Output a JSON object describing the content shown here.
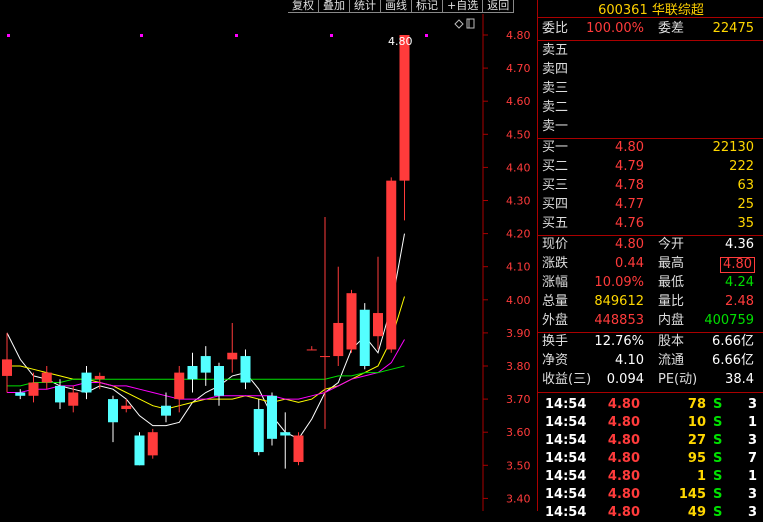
{
  "toolbar": [
    "复权",
    "叠加",
    "统计",
    "画线",
    "标记",
    "+自选",
    "返回"
  ],
  "stock": {
    "code": "600361",
    "name": "华联综超"
  },
  "order_ratio": {
    "label1": "委比",
    "value1": "100.00%",
    "label2": "委差",
    "value2": "22475"
  },
  "sell": [
    {
      "label": "卖五"
    },
    {
      "label": "卖四"
    },
    {
      "label": "卖三"
    },
    {
      "label": "卖二"
    },
    {
      "label": "卖一"
    }
  ],
  "buy": [
    {
      "label": "买一",
      "price": "4.80",
      "vol": "22130"
    },
    {
      "label": "买二",
      "price": "4.79",
      "vol": "222"
    },
    {
      "label": "买三",
      "price": "4.78",
      "vol": "63"
    },
    {
      "label": "买四",
      "price": "4.77",
      "vol": "25"
    },
    {
      "label": "买五",
      "price": "4.76",
      "vol": "35"
    }
  ],
  "quote": {
    "now_label": "现价",
    "now": "4.80",
    "open_label": "今开",
    "open": "4.36",
    "chg_label": "涨跌",
    "chg": "0.44",
    "high_label": "最高",
    "high": "4.80",
    "pct_label": "涨幅",
    "pct": "10.09%",
    "low_label": "最低",
    "low": "4.24",
    "vol_label": "总量",
    "vol": "849612",
    "vr_label": "量比",
    "vr": "2.48",
    "out_label": "外盘",
    "out": "448853",
    "in_label": "内盘",
    "in": "400759"
  },
  "fund": {
    "turn_label": "换手",
    "turn": "12.76%",
    "cap_label": "股本",
    "cap": "6.66亿",
    "nav_label": "净资",
    "nav": "4.10",
    "float_label": "流通",
    "float": "6.66亿",
    "eps_label": "收益(三)",
    "eps": "0.094",
    "pe_label": "PE(动)",
    "pe": "38.4"
  },
  "ticks": [
    {
      "time": "14:54",
      "price": "4.80",
      "vol": "78",
      "side": "S",
      "n": "3"
    },
    {
      "time": "14:54",
      "price": "4.80",
      "vol": "10",
      "side": "S",
      "n": "1"
    },
    {
      "time": "14:54",
      "price": "4.80",
      "vol": "27",
      "side": "S",
      "n": "3"
    },
    {
      "time": "14:54",
      "price": "4.80",
      "vol": "95",
      "side": "S",
      "n": "7"
    },
    {
      "time": "14:54",
      "price": "4.80",
      "vol": "1",
      "side": "S",
      "n": "1"
    },
    {
      "time": "14:54",
      "price": "4.80",
      "vol": "145",
      "side": "S",
      "n": "3"
    },
    {
      "time": "14:54",
      "price": "4.80",
      "vol": "49",
      "side": "S",
      "n": "3"
    }
  ],
  "chart_data": {
    "type": "candlestick",
    "y_ticks": [
      "4.80",
      "4.70",
      "4.60",
      "4.50",
      "4.40",
      "4.30",
      "4.20",
      "4.10",
      "4.00",
      "3.90",
      "3.80",
      "3.70",
      "3.60",
      "3.50",
      "3.40"
    ],
    "high_marker": "4.80",
    "ylim": [
      3.35,
      4.83
    ],
    "candles": [
      {
        "o": 3.77,
        "c": 3.82,
        "h": 3.9,
        "l": 3.72
      },
      {
        "o": 3.72,
        "c": 3.71,
        "h": 3.73,
        "l": 3.7
      },
      {
        "o": 3.71,
        "c": 3.75,
        "h": 3.78,
        "l": 3.69
      },
      {
        "o": 3.75,
        "c": 3.78,
        "h": 3.8,
        "l": 3.73
      },
      {
        "o": 3.74,
        "c": 3.69,
        "h": 3.76,
        "l": 3.67
      },
      {
        "o": 3.68,
        "c": 3.72,
        "h": 3.74,
        "l": 3.66
      },
      {
        "o": 3.78,
        "c": 3.72,
        "h": 3.8,
        "l": 3.7
      },
      {
        "o": 3.76,
        "c": 3.77,
        "h": 3.78,
        "l": 3.73
      },
      {
        "o": 3.7,
        "c": 3.63,
        "h": 3.71,
        "l": 3.57
      },
      {
        "o": 3.67,
        "c": 3.68,
        "h": 3.7,
        "l": 3.66
      },
      {
        "o": 3.59,
        "c": 3.5,
        "h": 3.6,
        "l": 3.5
      },
      {
        "o": 3.53,
        "c": 3.6,
        "h": 3.61,
        "l": 3.52
      },
      {
        "o": 3.68,
        "c": 3.65,
        "h": 3.72,
        "l": 3.63
      },
      {
        "o": 3.7,
        "c": 3.78,
        "h": 3.8,
        "l": 3.66
      },
      {
        "o": 3.8,
        "c": 3.76,
        "h": 3.84,
        "l": 3.72
      },
      {
        "o": 3.83,
        "c": 3.78,
        "h": 3.86,
        "l": 3.74
      },
      {
        "o": 3.8,
        "c": 3.71,
        "h": 3.81,
        "l": 3.68
      },
      {
        "o": 3.82,
        "c": 3.84,
        "h": 3.93,
        "l": 3.78
      },
      {
        "o": 3.83,
        "c": 3.75,
        "h": 3.85,
        "l": 3.73
      },
      {
        "o": 3.67,
        "c": 3.54,
        "h": 3.7,
        "l": 3.53
      },
      {
        "o": 3.71,
        "c": 3.58,
        "h": 3.72,
        "l": 3.56
      },
      {
        "o": 3.6,
        "c": 3.59,
        "h": 3.66,
        "l": 3.49
      },
      {
        "o": 3.51,
        "c": 3.59,
        "h": 3.6,
        "l": 3.5
      },
      {
        "o": 3.85,
        "c": 3.85,
        "h": 3.86,
        "l": 3.85
      },
      {
        "o": 3.83,
        "c": 3.83,
        "h": 4.25,
        "l": 3.61
      },
      {
        "o": 3.83,
        "c": 3.93,
        "h": 4.1,
        "l": 3.8
      },
      {
        "o": 3.85,
        "c": 4.02,
        "h": 4.03,
        "l": 3.84
      },
      {
        "o": 3.97,
        "c": 3.8,
        "h": 3.99,
        "l": 3.79
      },
      {
        "o": 3.89,
        "c": 3.96,
        "h": 4.13,
        "l": 3.85
      },
      {
        "o": 3.85,
        "c": 4.36,
        "h": 4.37,
        "l": 3.84
      },
      {
        "o": 4.36,
        "c": 4.8,
        "h": 4.8,
        "l": 4.24
      }
    ],
    "ma": [
      {
        "name": "ma5",
        "color": "#ffffff",
        "values": [
          3.9,
          3.82,
          3.77,
          3.76,
          3.74,
          3.73,
          3.72,
          3.74,
          3.73,
          3.7,
          3.65,
          3.62,
          3.62,
          3.63,
          3.69,
          3.72,
          3.74,
          3.77,
          3.78,
          3.73,
          3.65,
          3.6,
          3.58,
          3.64,
          3.72,
          3.75,
          3.85,
          3.89,
          3.84,
          3.98,
          4.2
        ]
      },
      {
        "name": "ma10",
        "color": "#ffff00",
        "values": [
          3.8,
          3.8,
          3.79,
          3.78,
          3.77,
          3.76,
          3.76,
          3.75,
          3.74,
          3.72,
          3.7,
          3.68,
          3.67,
          3.68,
          3.69,
          3.7,
          3.7,
          3.7,
          3.71,
          3.7,
          3.69,
          3.7,
          3.69,
          3.7,
          3.73,
          3.74,
          3.76,
          3.78,
          3.8,
          3.88,
          4.01
        ]
      },
      {
        "name": "ma20",
        "color": "#ff00ff",
        "values": [
          3.72,
          3.72,
          3.73,
          3.73,
          3.74,
          3.74,
          3.75,
          3.75,
          3.74,
          3.74,
          3.73,
          3.72,
          3.71,
          3.7,
          3.7,
          3.7,
          3.71,
          3.71,
          3.71,
          3.71,
          3.71,
          3.7,
          3.7,
          3.71,
          3.72,
          3.74,
          3.76,
          3.77,
          3.78,
          3.81,
          3.88
        ]
      },
      {
        "name": "ma60",
        "color": "#00e000",
        "values": [
          3.74,
          3.74,
          3.75,
          3.75,
          3.75,
          3.76,
          3.76,
          3.76,
          3.76,
          3.76,
          3.76,
          3.76,
          3.76,
          3.76,
          3.76,
          3.76,
          3.76,
          3.76,
          3.76,
          3.76,
          3.76,
          3.76,
          3.76,
          3.76,
          3.76,
          3.77,
          3.77,
          3.78,
          3.78,
          3.79,
          3.8
        ]
      }
    ]
  }
}
